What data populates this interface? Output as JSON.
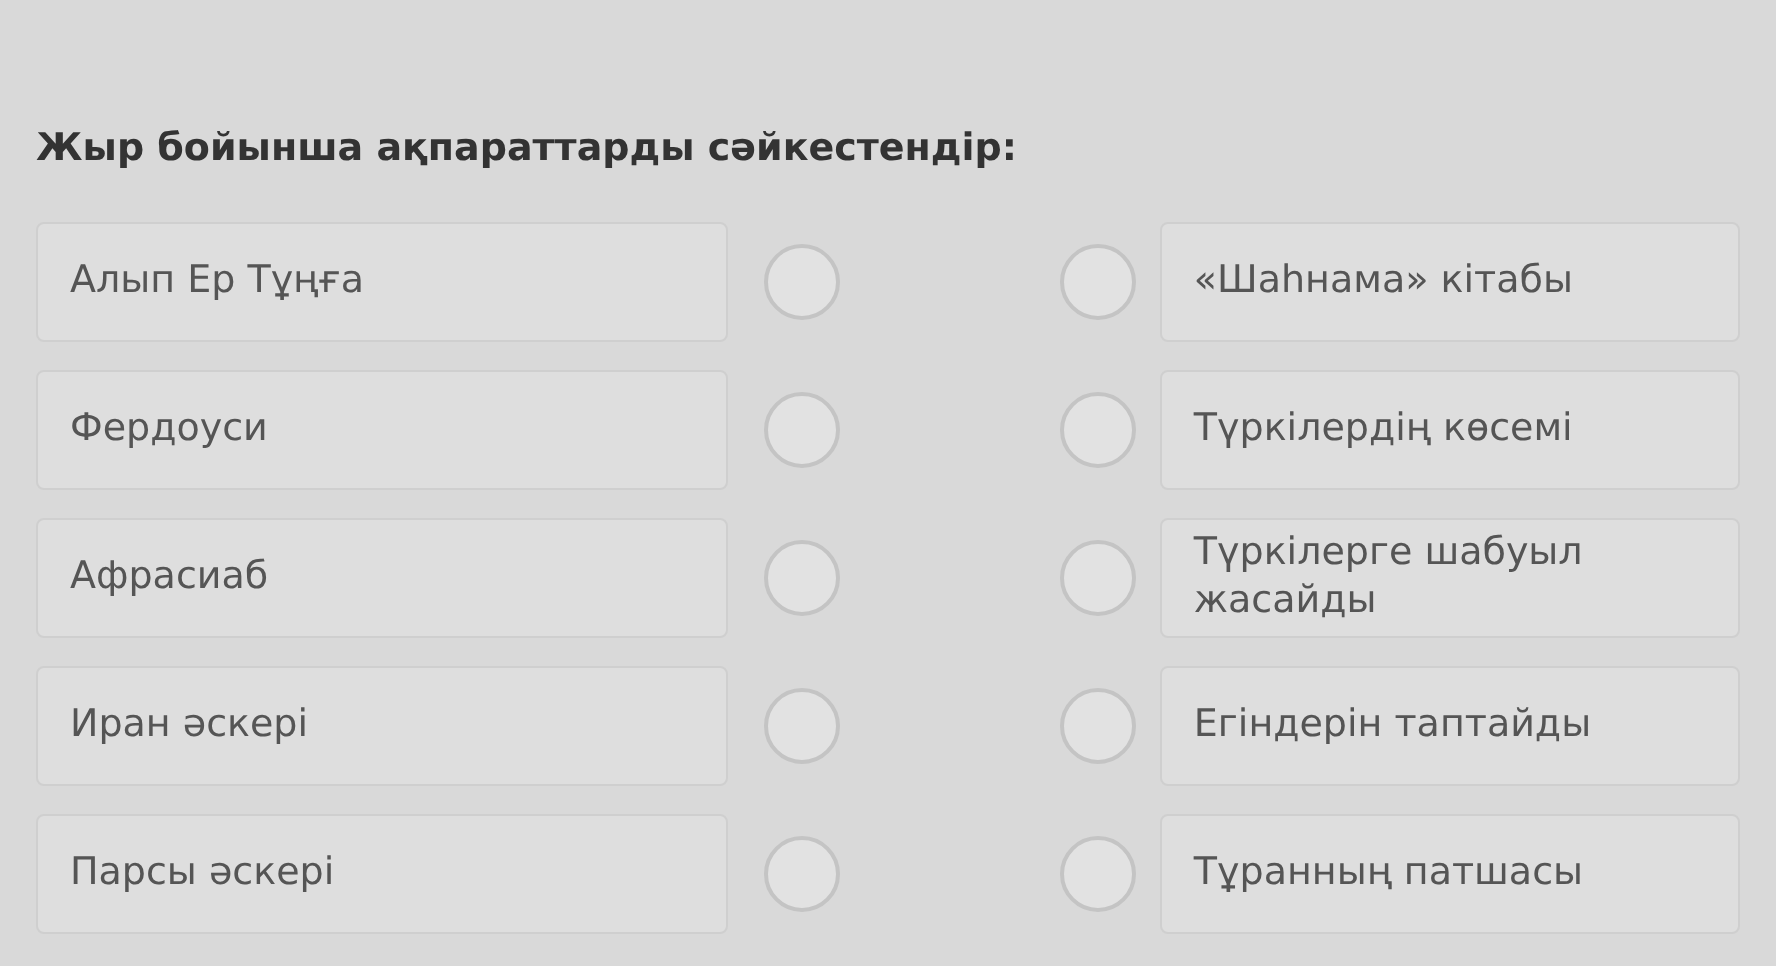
{
  "title": "Жыр бойынша ақпараттарды сәйкестендір:",
  "left_items": [
    {
      "label": "Алып Ер Тұңға",
      "selected": false
    },
    {
      "label": "Фердоуси",
      "selected": false
    },
    {
      "label": "Афрасиаб",
      "selected": false
    },
    {
      "label": "Иран әскері",
      "selected": false
    },
    {
      "label": "Парсы әскері",
      "selected": false
    }
  ],
  "right_items": [
    {
      "label": "«Шаһнама» кітабы",
      "selected": false
    },
    {
      "label": "Түркілердің көсемі",
      "selected": false
    },
    {
      "label": "Түркілерге шабуыл жасайды",
      "selected": false
    },
    {
      "label": "Егіндерін таптайды",
      "selected": false
    },
    {
      "label": "Тұранның патшасы",
      "selected": false
    }
  ]
}
